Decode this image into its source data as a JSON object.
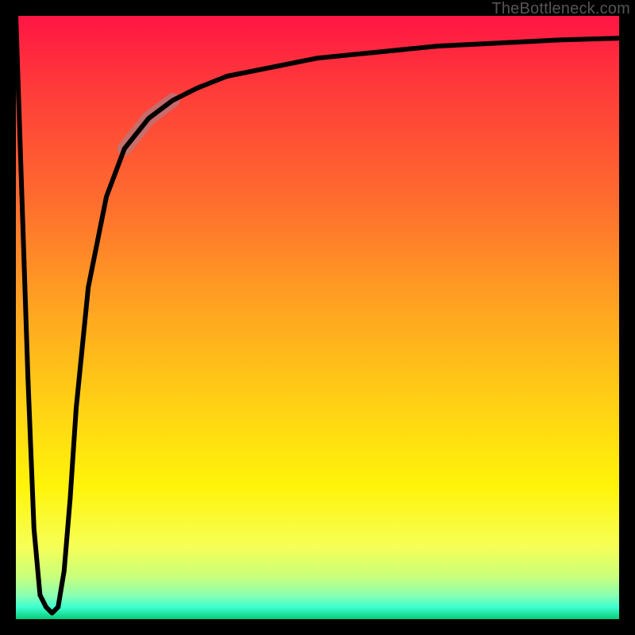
{
  "attribution": "TheBottleneck.com",
  "colors": {
    "frame": "#000000",
    "curve_stroke": "#000000",
    "highlight_stroke": "rgba(180,120,125,0.75)",
    "gradient_top": "#ff1544",
    "gradient_mid": "#fff40a",
    "gradient_bottom": "#06cc7a"
  },
  "chart_data": {
    "type": "line",
    "title": "",
    "xlabel": "",
    "ylabel": "",
    "x_range": [
      0,
      100
    ],
    "y_range": [
      0,
      100
    ],
    "grid": false,
    "legend": false,
    "notes": "Unlabeled bottleneck-style curve over a red→yellow→green vertical gradient. Left vertical edge drops from top to near bottom, then a sharp V-shaped dip, then a steep rise that asymptotes near the top-right. A short translucent pink segment highlights part of the rising limb.",
    "series": [
      {
        "name": "curve",
        "x": [
          0,
          1,
          2,
          3,
          4,
          5,
          6,
          7,
          8,
          9,
          10,
          12,
          15,
          18,
          22,
          26,
          30,
          35,
          40,
          50,
          60,
          70,
          80,
          90,
          100
        ],
        "y": [
          100,
          70,
          40,
          15,
          4,
          2,
          1,
          2,
          8,
          20,
          35,
          55,
          70,
          78,
          83,
          86,
          88,
          90,
          91,
          93,
          94,
          95,
          95.5,
          96,
          96.3
        ]
      }
    ],
    "highlight_segment": {
      "x_start": 18,
      "x_end": 26
    }
  }
}
